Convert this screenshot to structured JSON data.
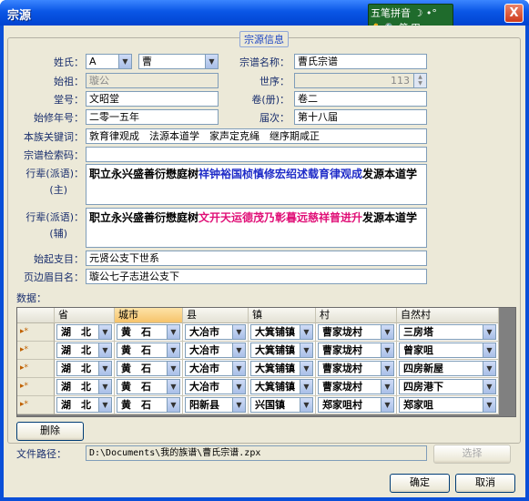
{
  "window": {
    "title": "宗源"
  },
  "titlebar": {
    "close_label": "X"
  },
  "ime": {
    "mode_label": "五笔拼音",
    "row1_extra": "☽ •°",
    "row2": "✋ 🔍 简 田"
  },
  "group": {
    "title": "宗源信息"
  },
  "form": {
    "surname_label": "姓氏：",
    "surname_letter": "A",
    "surname_value": "曹",
    "genealogy_name_label": "宗谱名称：",
    "genealogy_name_value": "曹氏宗谱",
    "ancestor_label": "始祖：",
    "ancestor_value": "璇公",
    "generation_label": "世序：",
    "generation_value": "113",
    "hall_label": "堂号：",
    "hall_value": "文昭堂",
    "volume_label": "卷(册)：",
    "volume_value": "卷二",
    "first_year_label": "始修年号：",
    "first_year_value": "二零一五年",
    "edition_label": "届次：",
    "edition_value": "第十八届",
    "keywords_label": "本族关键词：",
    "keywords_value": "敦育律观成　法源本道学　家声定克绳　继序期咸正",
    "search_code_label": "宗谱检索码：",
    "search_code_value": "",
    "generation_main_label": "行辈(派语)：",
    "generation_main_sublabel": "(主)",
    "generation_main_black1": "职立永兴盛善衍懋庭树",
    "generation_main_blue": "祥钟裕国桢慎修宏绍述载育律观成",
    "generation_main_black2": "发源本道学",
    "generation_aux_label": "行辈(派语)：",
    "generation_aux_sublabel": "(辅)",
    "generation_aux_black1": "职立永兴盛善衍懋庭树",
    "generation_aux_red": "文开天运德茂乃彰暮远慈祥普进升",
    "generation_aux_black2": "发源本道学",
    "origin_branch_label": "始起支目：",
    "origin_branch_value": "元贤公支下世系",
    "page_header_label": "页边眉目名：",
    "page_header_value": "璇公七子志进公支下"
  },
  "data_label": "数据：",
  "grid": {
    "columns": [
      "",
      "省",
      "城市",
      "县",
      "镇",
      "村",
      "自然村"
    ],
    "rows": [
      {
        "marker": "▸*",
        "province": "湖　北",
        "city": "黄　石",
        "county": "大冶市",
        "town": "大箕铺镇",
        "village": "曹家垅村",
        "hamlet": "三房塔"
      },
      {
        "marker": "▸*",
        "province": "湖　北",
        "city": "黄　石",
        "county": "大冶市",
        "town": "大箕铺镇",
        "village": "曹家垅村",
        "hamlet": "曾家咀"
      },
      {
        "marker": "▸*",
        "province": "湖　北",
        "city": "黄　石",
        "county": "大冶市",
        "town": "大箕铺镇",
        "village": "曹家垅村",
        "hamlet": "四房新屋"
      },
      {
        "marker": "▸*",
        "province": "湖　北",
        "city": "黄　石",
        "county": "大冶市",
        "town": "大箕铺镇",
        "village": "曹家垅村",
        "hamlet": "四房港下"
      },
      {
        "marker": "▸*",
        "province": "湖　北",
        "city": "黄　石",
        "county": "阳新县",
        "town": "兴国镇",
        "village": "郑家咀村",
        "hamlet": "郑家咀"
      }
    ]
  },
  "buttons": {
    "delete": "删除",
    "browse": "选择",
    "ok": "确定",
    "cancel": "取消"
  },
  "filepath": {
    "label": "文件路径：",
    "value": "D:\\Documents\\我的族谱\\曹氏宗谱.zpx"
  }
}
